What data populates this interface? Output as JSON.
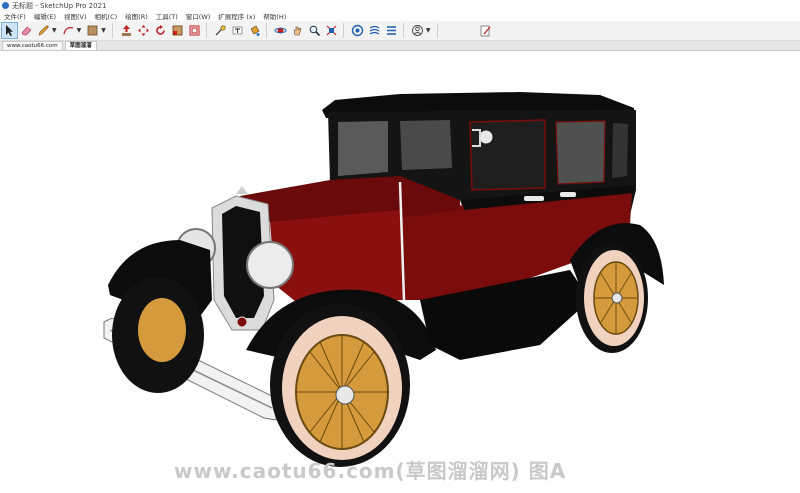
{
  "window": {
    "title": "无标题 - SketchUp Pro 2021"
  },
  "menu": {
    "items": [
      "文件(F)",
      "编辑(E)",
      "视图(V)",
      "相机(C)",
      "绘图(R)",
      "工具(T)",
      "窗口(W)",
      "扩展程序 (x)",
      "帮助(H)"
    ]
  },
  "toolbar": {
    "tools": [
      "select-icon",
      "eraser-icon",
      "pencil-icon",
      "arc-icon",
      "rectangle-icon",
      "push-pull-icon",
      "move-icon",
      "rotate-icon",
      "scale-icon",
      "offset-icon",
      "tape-measure-icon",
      "text-icon",
      "paint-bucket-icon",
      "orbit-icon",
      "pan-icon",
      "zoom-icon",
      "zoom-extents-icon",
      "3d-warehouse-icon",
      "extension-warehouse-icon",
      "layout-icon",
      "account-icon",
      "edit-note-icon"
    ]
  },
  "tabs": [
    "www.caotu66.com",
    "草图溜溜"
  ],
  "watermark": "www.caotu66.com(草图溜溜网) 图A",
  "colors": {
    "body_red": "#7a0c0c",
    "fender_black": "#0c0c0c",
    "wheel_gold": "#d49a3c",
    "tire_cream": "#f1d2bf",
    "chrome": "#dcdcdc",
    "window_gray": "#5a5a5a"
  }
}
